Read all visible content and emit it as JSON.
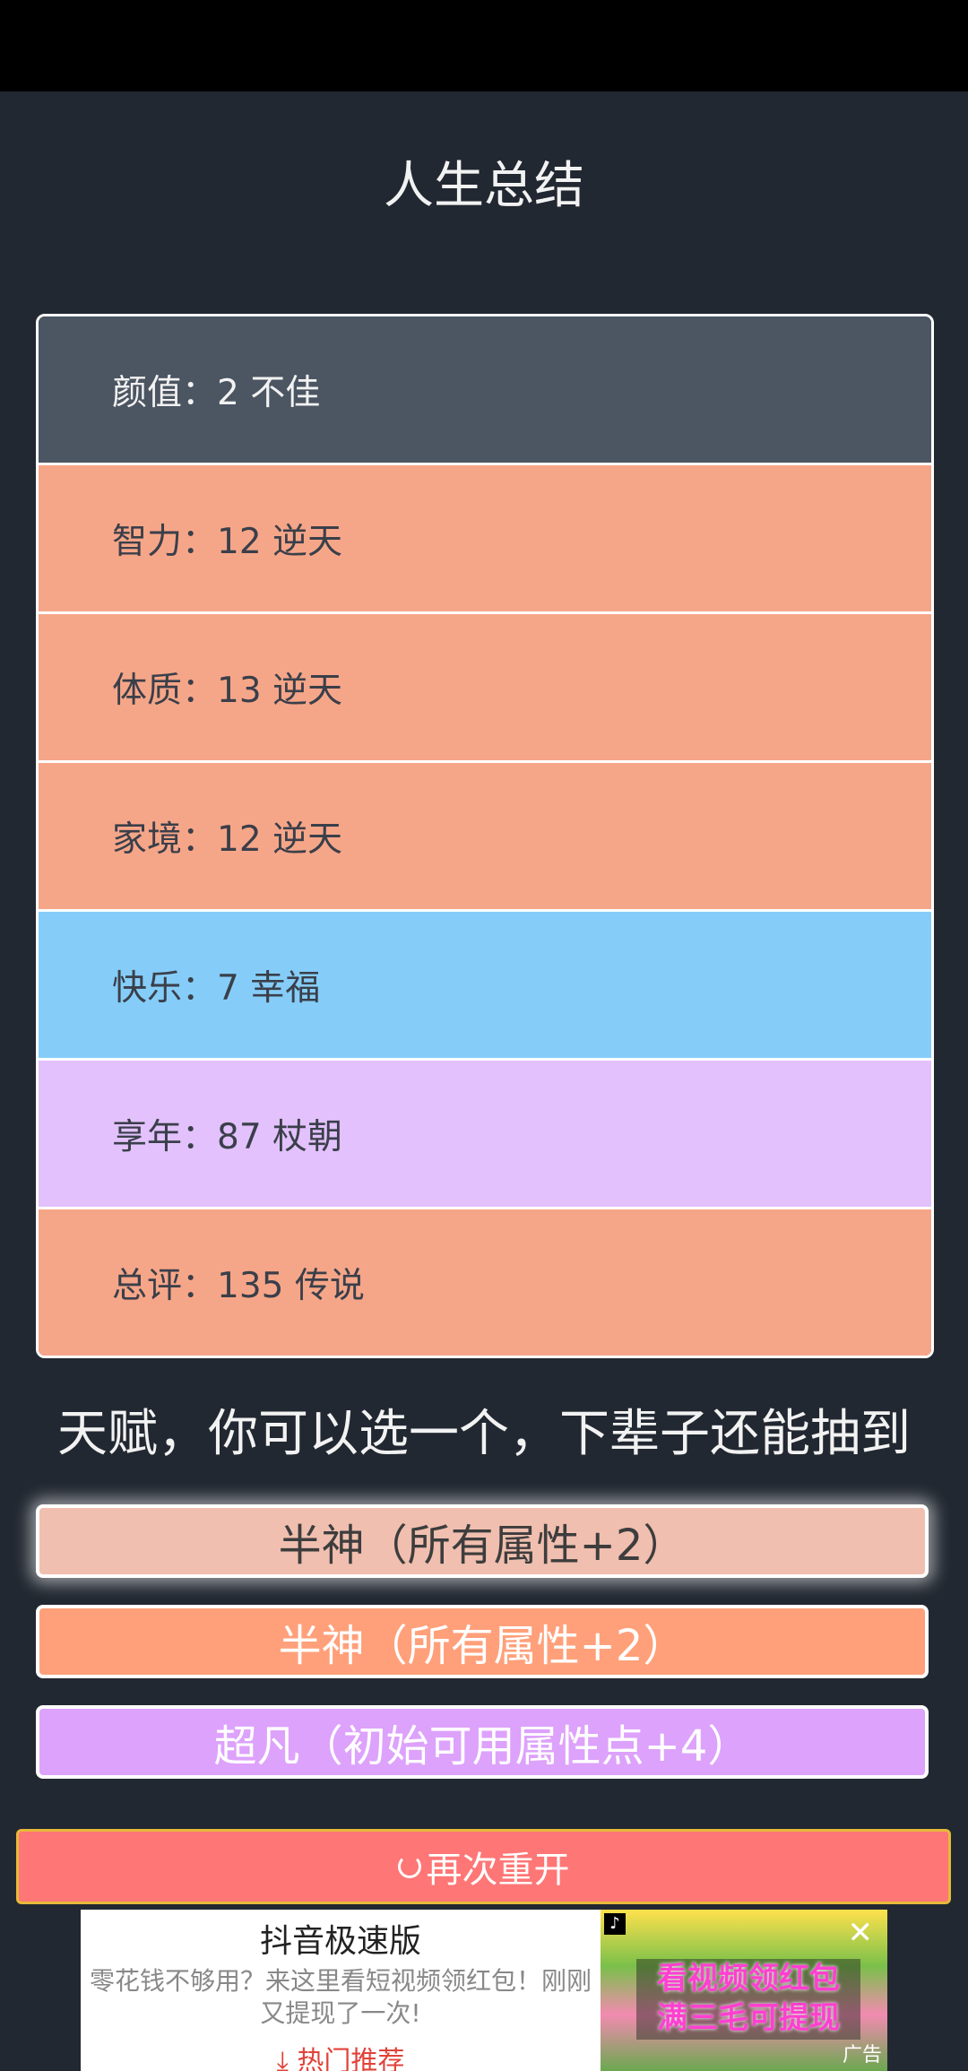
{
  "title": "人生总结",
  "summary": [
    {
      "label": "颜值：2 不佳",
      "color": "#4c5562"
    },
    {
      "label": "智力：12 逆天",
      "color": "#f6a688"
    },
    {
      "label": "体质：13 逆天",
      "color": "#f6a688"
    },
    {
      "label": "家境：12 逆天",
      "color": "#f6a688"
    },
    {
      "label": "快乐：7 幸福",
      "color": "#85cdf8"
    },
    {
      "label": "享年：87 杖朝",
      "color": "#e3c1fc"
    },
    {
      "label": "总评：135 传说",
      "color": "#f6a688"
    }
  ],
  "talent_heading": "天赋，你可以选一个，下辈子还能抽到",
  "talents": [
    {
      "label": "半神（所有属性+2）",
      "bg": "#f0bfaf",
      "text_color": "#3d3d3d",
      "selected": true
    },
    {
      "label": "半神（所有属性+2）",
      "bg": "#ffa07a",
      "text_color": "#ffffff",
      "selected": false
    },
    {
      "label": "超凡（初始可用属性点+4）",
      "bg": "#dda2fb",
      "text_color": "#ffffff",
      "selected": false
    }
  ],
  "restart": {
    "label": "再次重开",
    "icon": "refresh-icon"
  },
  "ad": {
    "title": "抖音极速版",
    "desc": "零花钱不够用？来这里看短视频领红包！刚刚又提现了一次!",
    "cta": "热门推荐",
    "banner": "看视频领红包\n满三毛可提现",
    "label": "广告",
    "close": "✕"
  }
}
